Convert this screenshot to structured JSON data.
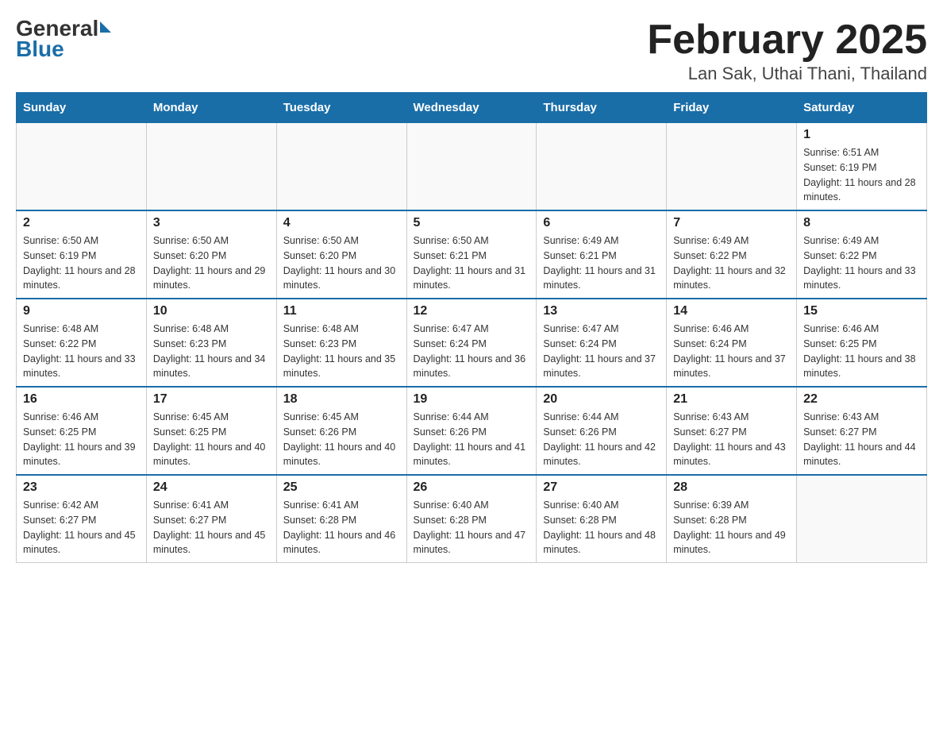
{
  "logo": {
    "general": "General",
    "blue": "Blue"
  },
  "title": "February 2025",
  "subtitle": "Lan Sak, Uthai Thani, Thailand",
  "days_of_week": [
    "Sunday",
    "Monday",
    "Tuesday",
    "Wednesday",
    "Thursday",
    "Friday",
    "Saturday"
  ],
  "weeks": [
    [
      {
        "day": "",
        "info": ""
      },
      {
        "day": "",
        "info": ""
      },
      {
        "day": "",
        "info": ""
      },
      {
        "day": "",
        "info": ""
      },
      {
        "day": "",
        "info": ""
      },
      {
        "day": "",
        "info": ""
      },
      {
        "day": "1",
        "info": "Sunrise: 6:51 AM\nSunset: 6:19 PM\nDaylight: 11 hours and 28 minutes."
      }
    ],
    [
      {
        "day": "2",
        "info": "Sunrise: 6:50 AM\nSunset: 6:19 PM\nDaylight: 11 hours and 28 minutes."
      },
      {
        "day": "3",
        "info": "Sunrise: 6:50 AM\nSunset: 6:20 PM\nDaylight: 11 hours and 29 minutes."
      },
      {
        "day": "4",
        "info": "Sunrise: 6:50 AM\nSunset: 6:20 PM\nDaylight: 11 hours and 30 minutes."
      },
      {
        "day": "5",
        "info": "Sunrise: 6:50 AM\nSunset: 6:21 PM\nDaylight: 11 hours and 31 minutes."
      },
      {
        "day": "6",
        "info": "Sunrise: 6:49 AM\nSunset: 6:21 PM\nDaylight: 11 hours and 31 minutes."
      },
      {
        "day": "7",
        "info": "Sunrise: 6:49 AM\nSunset: 6:22 PM\nDaylight: 11 hours and 32 minutes."
      },
      {
        "day": "8",
        "info": "Sunrise: 6:49 AM\nSunset: 6:22 PM\nDaylight: 11 hours and 33 minutes."
      }
    ],
    [
      {
        "day": "9",
        "info": "Sunrise: 6:48 AM\nSunset: 6:22 PM\nDaylight: 11 hours and 33 minutes."
      },
      {
        "day": "10",
        "info": "Sunrise: 6:48 AM\nSunset: 6:23 PM\nDaylight: 11 hours and 34 minutes."
      },
      {
        "day": "11",
        "info": "Sunrise: 6:48 AM\nSunset: 6:23 PM\nDaylight: 11 hours and 35 minutes."
      },
      {
        "day": "12",
        "info": "Sunrise: 6:47 AM\nSunset: 6:24 PM\nDaylight: 11 hours and 36 minutes."
      },
      {
        "day": "13",
        "info": "Sunrise: 6:47 AM\nSunset: 6:24 PM\nDaylight: 11 hours and 37 minutes."
      },
      {
        "day": "14",
        "info": "Sunrise: 6:46 AM\nSunset: 6:24 PM\nDaylight: 11 hours and 37 minutes."
      },
      {
        "day": "15",
        "info": "Sunrise: 6:46 AM\nSunset: 6:25 PM\nDaylight: 11 hours and 38 minutes."
      }
    ],
    [
      {
        "day": "16",
        "info": "Sunrise: 6:46 AM\nSunset: 6:25 PM\nDaylight: 11 hours and 39 minutes."
      },
      {
        "day": "17",
        "info": "Sunrise: 6:45 AM\nSunset: 6:25 PM\nDaylight: 11 hours and 40 minutes."
      },
      {
        "day": "18",
        "info": "Sunrise: 6:45 AM\nSunset: 6:26 PM\nDaylight: 11 hours and 40 minutes."
      },
      {
        "day": "19",
        "info": "Sunrise: 6:44 AM\nSunset: 6:26 PM\nDaylight: 11 hours and 41 minutes."
      },
      {
        "day": "20",
        "info": "Sunrise: 6:44 AM\nSunset: 6:26 PM\nDaylight: 11 hours and 42 minutes."
      },
      {
        "day": "21",
        "info": "Sunrise: 6:43 AM\nSunset: 6:27 PM\nDaylight: 11 hours and 43 minutes."
      },
      {
        "day": "22",
        "info": "Sunrise: 6:43 AM\nSunset: 6:27 PM\nDaylight: 11 hours and 44 minutes."
      }
    ],
    [
      {
        "day": "23",
        "info": "Sunrise: 6:42 AM\nSunset: 6:27 PM\nDaylight: 11 hours and 45 minutes."
      },
      {
        "day": "24",
        "info": "Sunrise: 6:41 AM\nSunset: 6:27 PM\nDaylight: 11 hours and 45 minutes."
      },
      {
        "day": "25",
        "info": "Sunrise: 6:41 AM\nSunset: 6:28 PM\nDaylight: 11 hours and 46 minutes."
      },
      {
        "day": "26",
        "info": "Sunrise: 6:40 AM\nSunset: 6:28 PM\nDaylight: 11 hours and 47 minutes."
      },
      {
        "day": "27",
        "info": "Sunrise: 6:40 AM\nSunset: 6:28 PM\nDaylight: 11 hours and 48 minutes."
      },
      {
        "day": "28",
        "info": "Sunrise: 6:39 AM\nSunset: 6:28 PM\nDaylight: 11 hours and 49 minutes."
      },
      {
        "day": "",
        "info": ""
      }
    ]
  ]
}
